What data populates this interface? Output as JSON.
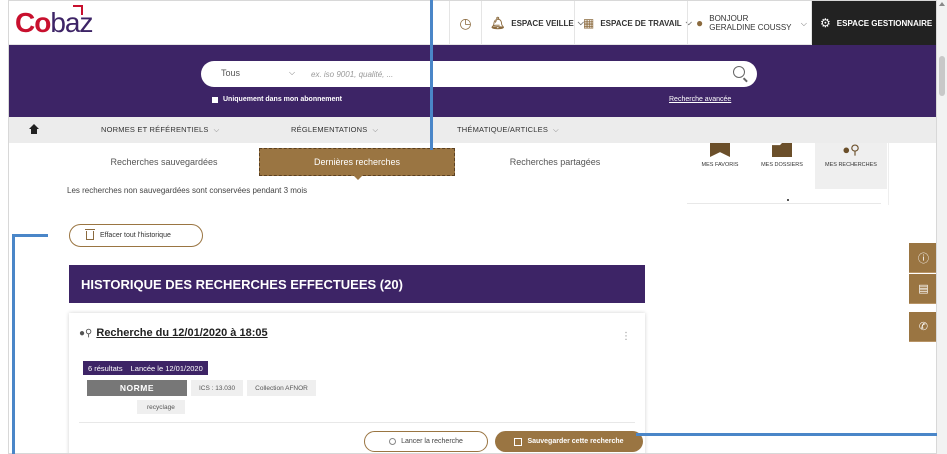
{
  "topbar": {
    "logo": {
      "co": "Co",
      "baz": "baz"
    },
    "veille": "ESPACE VEILLE",
    "travail": "ESPACE DE TRAVAIL",
    "bonjour_line1": "BONJOUR",
    "bonjour_line2": "GERALDINE COUSSY",
    "gestion": "ESPACE GESTIONNAIRE"
  },
  "search": {
    "scope": "Tous",
    "placeholder": "ex. iso 9001, qualité, ...",
    "subscription_only": "Uniquement dans mon abonnement",
    "advanced": "Recherche avancée"
  },
  "nav": {
    "items": [
      "NORMES ET RÉFÉRENTIELS",
      "RÉGLEMENTATIONS",
      "THÉMATIQUE/ARTICLES"
    ]
  },
  "tabs": {
    "saved": "Recherches sauvegardées",
    "recent": "Dernières recherches",
    "shared": "Recherches partagées"
  },
  "info_text": "Les recherches non sauvegardées sont conservées pendant 3 mois",
  "right_panel": {
    "favoris": "MES FAVORIS",
    "dossiers": "MES DOSSIERS",
    "recherches": "MES RECHERCHES"
  },
  "clear_history": "Effacer tout l'historique",
  "history_title": "HISTORIQUE DES RECHERCHES EFFECTUEES (20)",
  "card": {
    "title": "Recherche du 12/01/2020 à 18:05",
    "results": "6 résultats",
    "launched": "Lancée le 12/01/2020",
    "norme": "NORME",
    "ics": "ICS : 13.030",
    "collection": "Collection AFNOR",
    "keyword": "recyclage",
    "launch_btn": "Lancer la recherche",
    "save_btn": "Sauvegarder cette recherche"
  },
  "colors": {
    "purple": "#3d2466",
    "brown": "#9a7542",
    "red": "#c8102e"
  }
}
